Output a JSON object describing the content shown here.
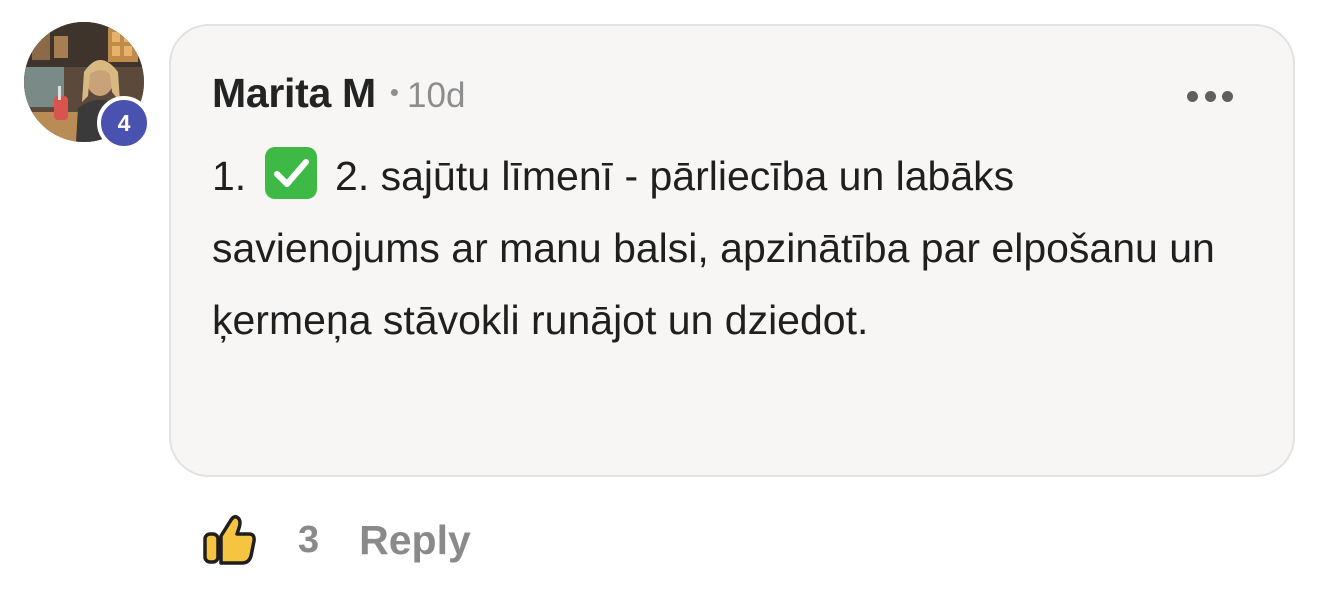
{
  "comment": {
    "author": "Marita M",
    "separator": "•",
    "time_ago": "10d",
    "level_badge": "4",
    "text_before_emoji": "1.",
    "emoji": "check-mark-button-icon",
    "text_after_emoji": "2. sajūtu līmenī - pārliecība un labāks savienojums ar manu balsi, apzinātība par elpošanu un ķermeņa stāvokli runājot un dziedot."
  },
  "actions": {
    "like_count": "3",
    "reply_label": "Reply"
  },
  "colors": {
    "bubble_background": "#f7f6f5",
    "bubble_border": "#e3e2e0",
    "badge_background": "#4a52b0",
    "check_green": "#3fb945",
    "thumb_yellow": "#f5c542",
    "muted_text": "#8a8a8a"
  }
}
